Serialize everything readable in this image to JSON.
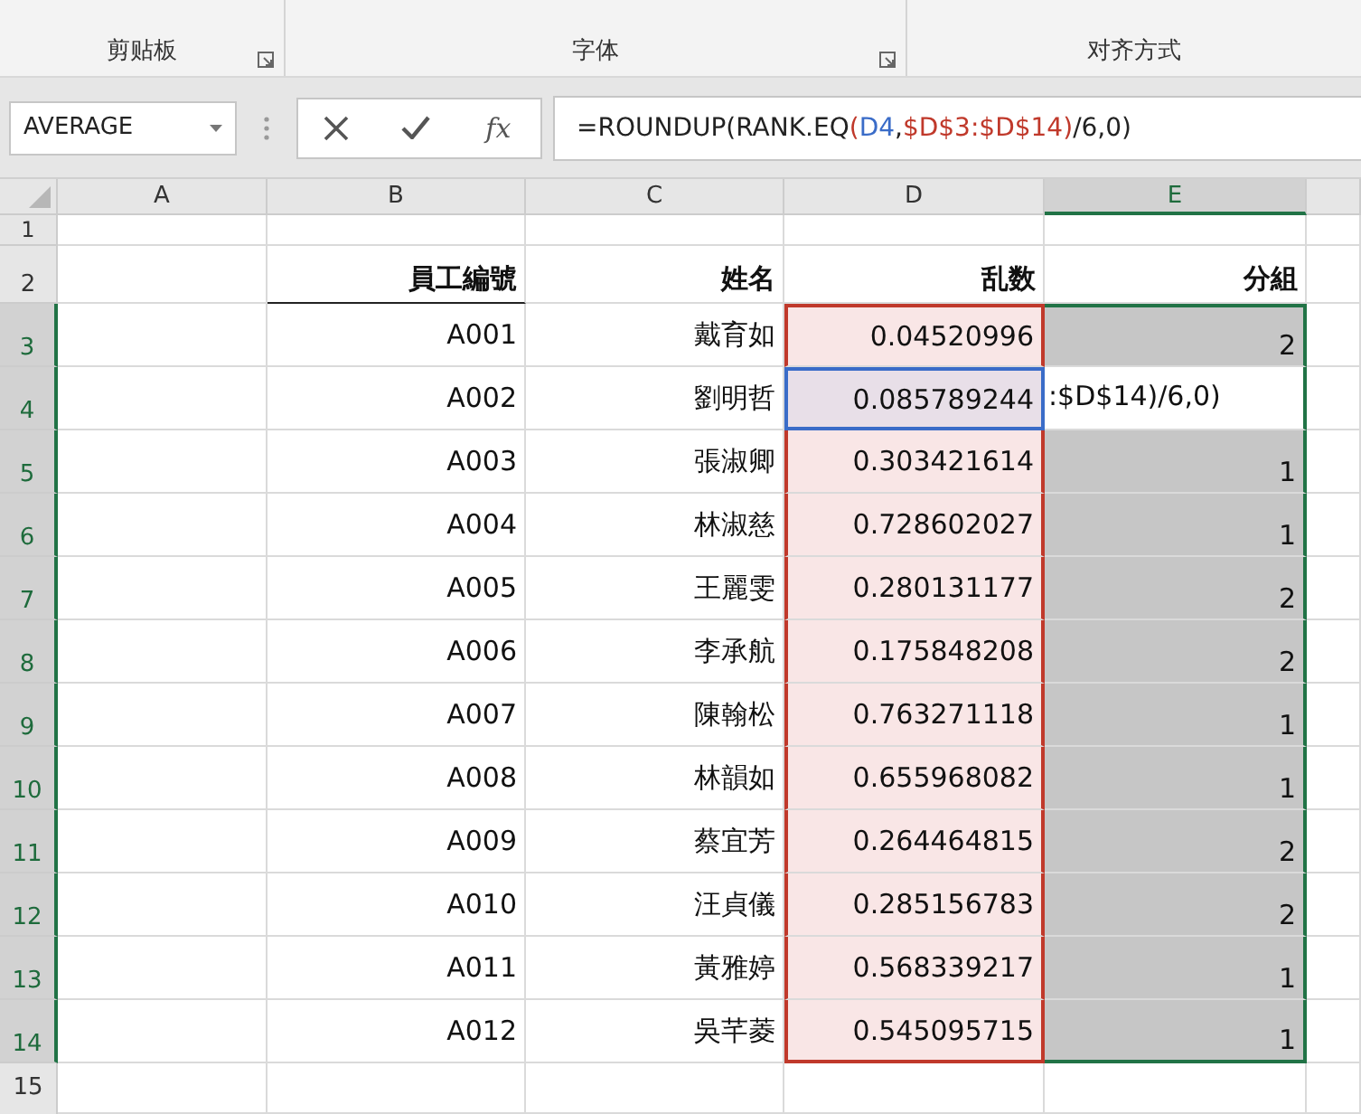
{
  "ribbon": {
    "groups": [
      {
        "label": "剪贴板",
        "launcher": true
      },
      {
        "label": "字体",
        "launcher": true
      },
      {
        "label": "对齐方式",
        "launcher": false
      }
    ]
  },
  "formula_bar": {
    "name_box": "AVERAGE",
    "fx": "fx",
    "formula": [
      {
        "text": "=ROUNDUP(RANK.EQ"
      },
      {
        "text": "(",
        "color": "#c0392b"
      },
      {
        "text": "D4",
        "color": "#3a6cc8"
      },
      {
        "text": ","
      },
      {
        "text": "$D$3:$D$14",
        "color": "#c0392b"
      },
      {
        "text": ")",
        "color": "#c0392b"
      },
      {
        "text": "/6,0)"
      }
    ]
  },
  "columns": [
    {
      "label": "A",
      "selected": false
    },
    {
      "label": "B",
      "selected": false
    },
    {
      "label": "C",
      "selected": false
    },
    {
      "label": "D",
      "selected": false
    },
    {
      "label": "E",
      "selected": true
    }
  ],
  "header_row": {
    "row": "2",
    "id": "員工編號",
    "name": "姓名",
    "random": "乱数",
    "group": "分組"
  },
  "rows": [
    {
      "row": "3",
      "id": "A001",
      "name": "戴育如",
      "random": "0.04520996",
      "group": "2",
      "selected": true,
      "active": false,
      "referenced": true,
      "ref_active": false
    },
    {
      "row": "4",
      "id": "A002",
      "name": "劉明哲",
      "random": "0.085789244",
      "edit_text": ":$D$14)/6,0)",
      "selected": true,
      "active": true,
      "referenced": true,
      "ref_active": true
    },
    {
      "row": "5",
      "id": "A003",
      "name": "張淑卿",
      "random": "0.303421614",
      "group": "1",
      "selected": true,
      "active": false,
      "referenced": true,
      "ref_active": false
    },
    {
      "row": "6",
      "id": "A004",
      "name": "林淑慈",
      "random": "0.728602027",
      "group": "1",
      "selected": true,
      "active": false,
      "referenced": true,
      "ref_active": false
    },
    {
      "row": "7",
      "id": "A005",
      "name": "王麗雯",
      "random": "0.280131177",
      "group": "2",
      "selected": true,
      "active": false,
      "referenced": true,
      "ref_active": false
    },
    {
      "row": "8",
      "id": "A006",
      "name": "李承航",
      "random": "0.175848208",
      "group": "2",
      "selected": true,
      "active": false,
      "referenced": true,
      "ref_active": false
    },
    {
      "row": "9",
      "id": "A007",
      "name": "陳翰松",
      "random": "0.763271118",
      "group": "1",
      "selected": true,
      "active": false,
      "referenced": true,
      "ref_active": false
    },
    {
      "row": "10",
      "id": "A008",
      "name": "林韻如",
      "random": "0.655968082",
      "group": "1",
      "selected": true,
      "active": false,
      "referenced": true,
      "ref_active": false
    },
    {
      "row": "11",
      "id": "A009",
      "name": "蔡宜芳",
      "random": "0.264464815",
      "group": "2",
      "selected": true,
      "active": false,
      "referenced": true,
      "ref_active": false
    },
    {
      "row": "12",
      "id": "A010",
      "name": "汪貞儀",
      "random": "0.285156783",
      "group": "2",
      "selected": true,
      "active": false,
      "referenced": true,
      "ref_active": false
    },
    {
      "row": "13",
      "id": "A011",
      "name": "黃雅婷",
      "random": "0.568339217",
      "group": "1",
      "selected": true,
      "active": false,
      "referenced": true,
      "ref_active": false
    },
    {
      "row": "14",
      "id": "A012",
      "name": "吳芊菱",
      "random": "0.545095715",
      "group": "1",
      "selected": true,
      "active": false,
      "referenced": true,
      "ref_active": false
    }
  ],
  "first_row": "1",
  "last_row": "15"
}
